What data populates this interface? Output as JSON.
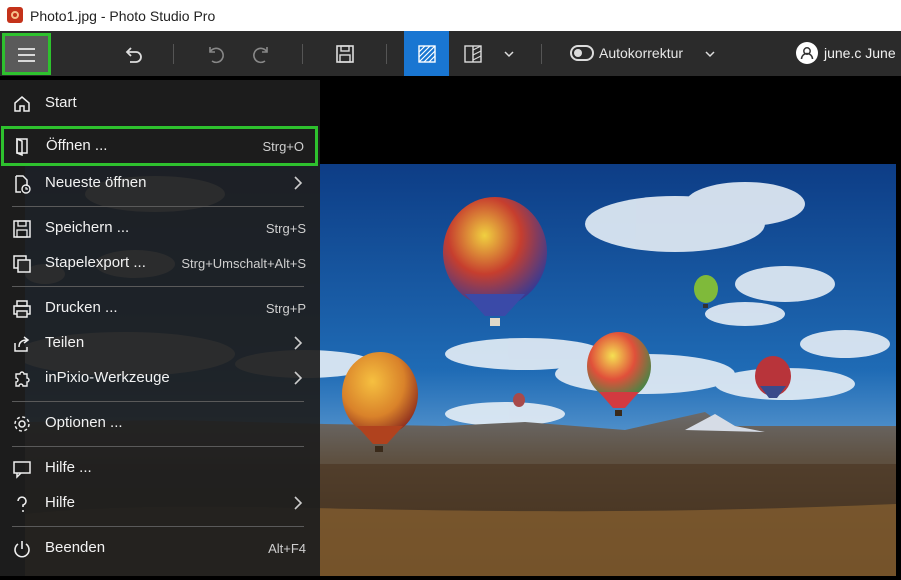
{
  "window": {
    "title": "Photo1.jpg - Photo Studio Pro"
  },
  "toolbar": {
    "autocorrect_label": "Autokorrektur",
    "user_name": "june.c June",
    "icons": [
      "menu-icon",
      "undo-icon",
      "undo-step-icon",
      "redo-icon",
      "save-icon",
      "view-single-icon",
      "compare-icon",
      "chevron-down-icon",
      "toggle-icon",
      "user-icon"
    ]
  },
  "menu": {
    "items": [
      {
        "label": "Start",
        "shortcut": "",
        "icon": "home-icon"
      },
      {
        "label": "Öffnen ...",
        "shortcut": "Strg+O",
        "icon": "open-icon"
      },
      {
        "label": "Neueste öffnen",
        "shortcut": "",
        "icon": "recent-files-icon"
      },
      {
        "label": "Speichern ...",
        "shortcut": "Strg+S",
        "icon": "save-icon"
      },
      {
        "label": "Stapelexport ...",
        "shortcut": "Strg+Umschalt+Alt+S",
        "icon": "batch-export-icon"
      },
      {
        "label": "Drucken ...",
        "shortcut": "Strg+P",
        "icon": "print-icon"
      },
      {
        "label": "Teilen",
        "shortcut": "",
        "icon": "share-icon"
      },
      {
        "label": "inPixio-Werkzeuge",
        "shortcut": "",
        "icon": "puzzle-icon"
      },
      {
        "label": "Optionen ...",
        "shortcut": "",
        "icon": "gear-icon"
      },
      {
        "label": "Hilfe ...",
        "shortcut": "",
        "icon": "chat-help-icon"
      },
      {
        "label": "Hilfe",
        "shortcut": "",
        "icon": "question-icon"
      },
      {
        "label": "Beenden",
        "shortcut": "Alt+F4",
        "icon": "power-icon"
      }
    ]
  },
  "colors": {
    "highlight": "#2ec12e",
    "active_tool": "#1976d2",
    "toolbar_bg": "#2b2b2b",
    "menu_bg": "#1e1e1e"
  }
}
